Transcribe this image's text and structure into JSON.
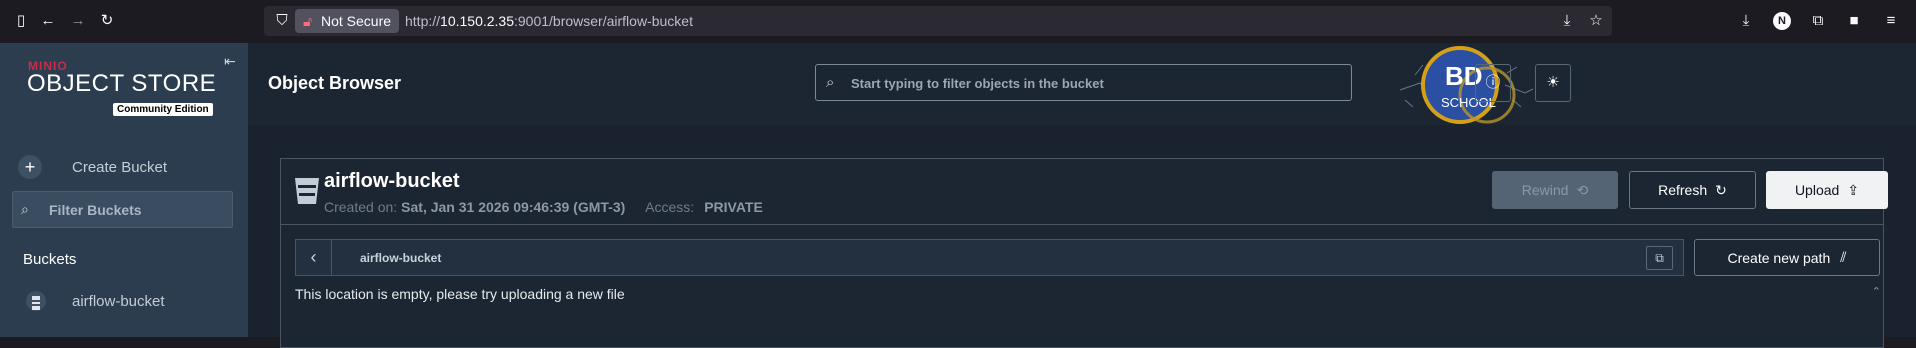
{
  "browser": {
    "security_label": "Not Secure",
    "url_prefix": "http://",
    "url_host": "10.150.2.35",
    "url_rest": ":9001/browser/airflow-bucket",
    "profile_initial": "N"
  },
  "sidebar": {
    "brand_small": "MINIO",
    "brand_large": "OBJECT STORE",
    "edition": "Community Edition",
    "create_bucket": "Create Bucket",
    "filter_placeholder": "Filter Buckets",
    "buckets_heading": "Buckets",
    "buckets": [
      {
        "name": "airflow-bucket"
      }
    ]
  },
  "header": {
    "title": "Object Browser",
    "search_placeholder": "Start typing to filter objects in the bucket",
    "logo_text_1": "BD",
    "logo_text_2": "SCHOOL"
  },
  "bucket": {
    "name": "airflow-bucket",
    "created_label": "Created on:",
    "created_value": "Sat, Jan 31 2026 09:46:39 (GMT-3)",
    "access_label": "Access:",
    "access_value": "PRIVATE",
    "rewind_label": "Rewind",
    "refresh_label": "Refresh",
    "upload_label": "Upload"
  },
  "path": {
    "current": "airflow-bucket",
    "create_new_path": "Create new path",
    "empty_message": "This location is empty, please try uploading a new file"
  },
  "colors": {
    "accent_red": "#c72c48",
    "sidebar_bg": "#2c3d4f",
    "main_bg": "#1c2532",
    "logo_gold": "#d4a017",
    "logo_blue": "#2a4fa3"
  }
}
